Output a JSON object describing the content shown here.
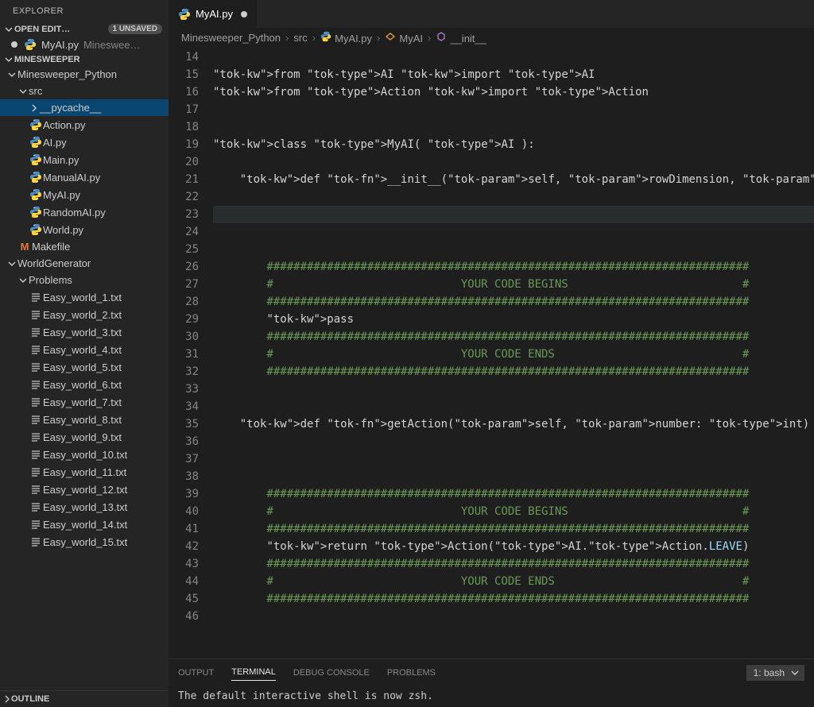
{
  "explorer": {
    "title": "EXPLORER",
    "openEditors": {
      "label": "OPEN EDIT…",
      "badge": "1 UNSAVED",
      "items": [
        {
          "name": "MyAI.py",
          "path": "Mineswee…",
          "modified": true
        }
      ]
    },
    "workspace": {
      "label": "MINESWEEPER"
    },
    "tree": [
      {
        "label": "Minesweeper_Python",
        "type": "folder",
        "indent": 0,
        "open": true
      },
      {
        "label": "src",
        "type": "folder",
        "indent": 1,
        "open": true
      },
      {
        "label": "__pycache__",
        "type": "folder",
        "indent": 2,
        "open": false,
        "selected": true
      },
      {
        "label": "Action.py",
        "type": "py",
        "indent": 2
      },
      {
        "label": "AI.py",
        "type": "py",
        "indent": 2
      },
      {
        "label": "Main.py",
        "type": "py",
        "indent": 2
      },
      {
        "label": "ManualAI.py",
        "type": "py",
        "indent": 2
      },
      {
        "label": "MyAI.py",
        "type": "py",
        "indent": 2
      },
      {
        "label": "RandomAI.py",
        "type": "py",
        "indent": 2
      },
      {
        "label": "World.py",
        "type": "py",
        "indent": 2
      },
      {
        "label": "Makefile",
        "type": "make",
        "indent": 1
      },
      {
        "label": "WorldGenerator",
        "type": "folder",
        "indent": 0,
        "open": true
      },
      {
        "label": "Problems",
        "type": "folder",
        "indent": 1,
        "open": true
      },
      {
        "label": "Easy_world_1.txt",
        "type": "txt",
        "indent": 2
      },
      {
        "label": "Easy_world_2.txt",
        "type": "txt",
        "indent": 2
      },
      {
        "label": "Easy_world_3.txt",
        "type": "txt",
        "indent": 2
      },
      {
        "label": "Easy_world_4.txt",
        "type": "txt",
        "indent": 2
      },
      {
        "label": "Easy_world_5.txt",
        "type": "txt",
        "indent": 2
      },
      {
        "label": "Easy_world_6.txt",
        "type": "txt",
        "indent": 2
      },
      {
        "label": "Easy_world_7.txt",
        "type": "txt",
        "indent": 2
      },
      {
        "label": "Easy_world_8.txt",
        "type": "txt",
        "indent": 2
      },
      {
        "label": "Easy_world_9.txt",
        "type": "txt",
        "indent": 2
      },
      {
        "label": "Easy_world_10.txt",
        "type": "txt",
        "indent": 2
      },
      {
        "label": "Easy_world_11.txt",
        "type": "txt",
        "indent": 2
      },
      {
        "label": "Easy_world_12.txt",
        "type": "txt",
        "indent": 2
      },
      {
        "label": "Easy_world_13.txt",
        "type": "txt",
        "indent": 2
      },
      {
        "label": "Easy_world_14.txt",
        "type": "txt",
        "indent": 2
      },
      {
        "label": "Easy_world_15.txt",
        "type": "txt",
        "indent": 2
      }
    ],
    "outline": {
      "label": "OUTLINE"
    }
  },
  "tabs": [
    {
      "name": "MyAI.py",
      "modified": true
    }
  ],
  "breadcrumbs": [
    {
      "label": "Minesweeper_Python",
      "icon": null
    },
    {
      "label": "src",
      "icon": null
    },
    {
      "label": "MyAI.py",
      "icon": "py"
    },
    {
      "label": "MyAI",
      "icon": "class"
    },
    {
      "label": "__init__",
      "icon": "method"
    }
  ],
  "editor": {
    "startLine": 14,
    "lines": [
      "",
      "from AI import AI",
      "from Action import Action",
      "",
      "",
      "class MyAI( AI ):",
      "",
      "    def __init__(self, rowDimension, colDimension, totalMines, startX, startY):",
      "",
      "",
      "",
      "",
      "        ########################################################################",
      "        #                            YOUR CODE BEGINS                          #",
      "        ########################################################################",
      "        pass",
      "        ########################################################################",
      "        #                            YOUR CODE ENDS                            #",
      "        ########################################################################",
      "",
      "",
      "    def getAction(self, number: int) -> \"Action Object\":",
      "",
      "",
      "",
      "        ########################################################################",
      "        #                            YOUR CODE BEGINS                          #",
      "        ########################################################################",
      "        return Action(AI.Action.LEAVE)",
      "        ########################################################################",
      "        #                            YOUR CODE ENDS                            #",
      "        ########################################################################",
      ""
    ],
    "highlightLine": 23
  },
  "panel": {
    "tabs": [
      "OUTPUT",
      "TERMINAL",
      "DEBUG CONSOLE",
      "PROBLEMS"
    ],
    "active": "TERMINAL",
    "terminalSelector": "1: bash",
    "terminalText": "The default interactive shell is now zsh."
  },
  "colors": {
    "accent": "#007acc",
    "selection": "#094771"
  }
}
